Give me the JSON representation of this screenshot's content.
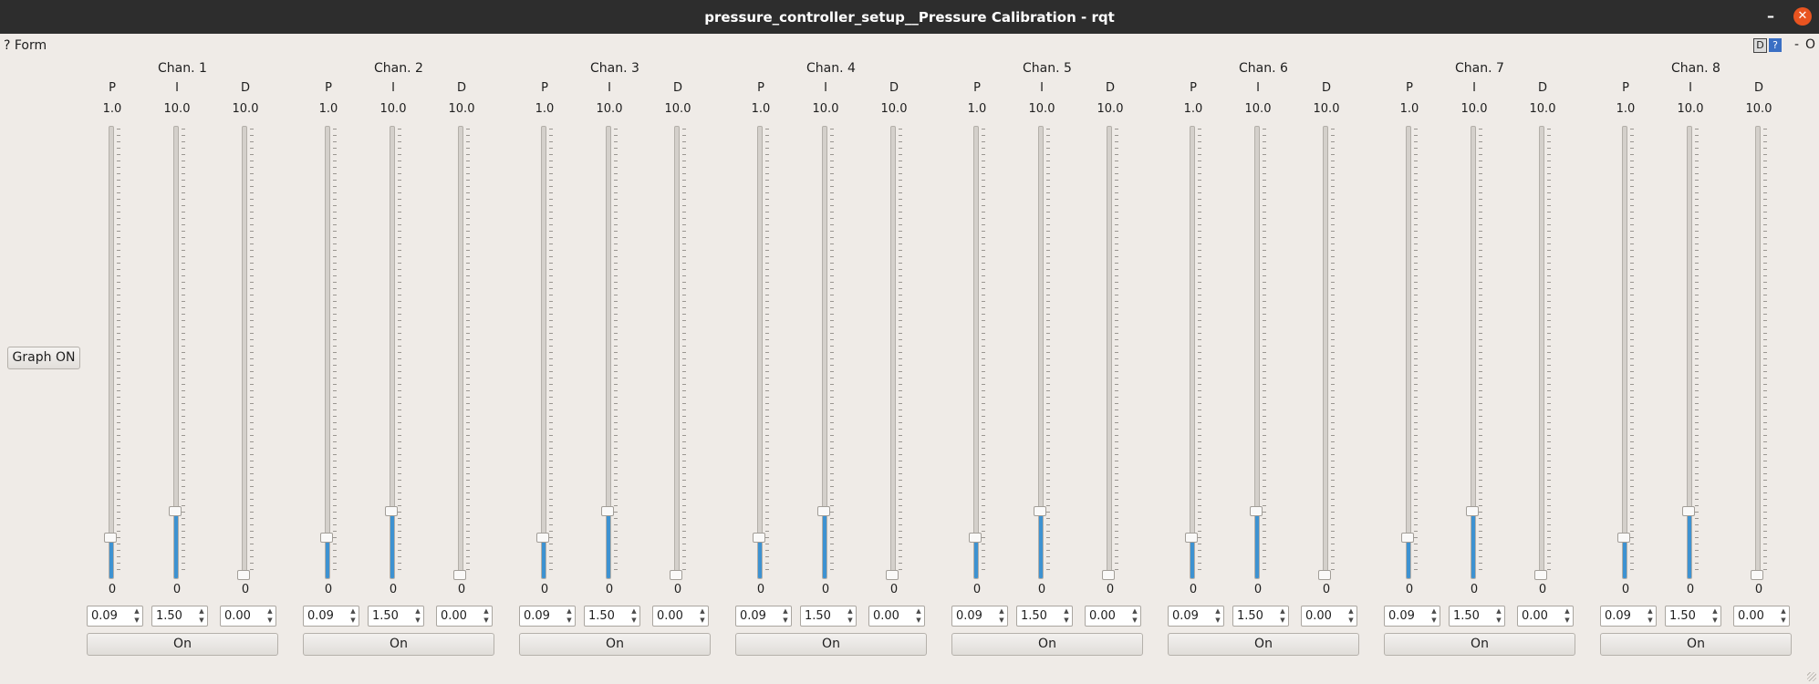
{
  "window": {
    "title": "pressure_controller_setup__Pressure Calibration - rqt",
    "minimize_glyph": "–",
    "close_glyph": "✕"
  },
  "plugin_bar": {
    "form_label": "? Form",
    "d_label": "D",
    "help_label": "?",
    "dash_label": "-",
    "o_label": "O"
  },
  "graph_button": "Graph ON",
  "channels": [
    {
      "title": "Chan. 1",
      "on_label": "On",
      "params": [
        {
          "name": "P",
          "max": "1.0",
          "min": "0",
          "value": "0.09",
          "level": 0.09
        },
        {
          "name": "I",
          "max": "10.0",
          "min": "0",
          "value": "1.50",
          "level": 0.15
        },
        {
          "name": "D",
          "max": "10.0",
          "min": "0",
          "value": "0.00",
          "level": 0.0
        }
      ]
    },
    {
      "title": "Chan. 2",
      "on_label": "On",
      "params": [
        {
          "name": "P",
          "max": "1.0",
          "min": "0",
          "value": "0.09",
          "level": 0.09
        },
        {
          "name": "I",
          "max": "10.0",
          "min": "0",
          "value": "1.50",
          "level": 0.15
        },
        {
          "name": "D",
          "max": "10.0",
          "min": "0",
          "value": "0.00",
          "level": 0.0
        }
      ]
    },
    {
      "title": "Chan. 3",
      "on_label": "On",
      "params": [
        {
          "name": "P",
          "max": "1.0",
          "min": "0",
          "value": "0.09",
          "level": 0.09
        },
        {
          "name": "I",
          "max": "10.0",
          "min": "0",
          "value": "1.50",
          "level": 0.15
        },
        {
          "name": "D",
          "max": "10.0",
          "min": "0",
          "value": "0.00",
          "level": 0.0
        }
      ]
    },
    {
      "title": "Chan. 4",
      "on_label": "On",
      "params": [
        {
          "name": "P",
          "max": "1.0",
          "min": "0",
          "value": "0.09",
          "level": 0.09
        },
        {
          "name": "I",
          "max": "10.0",
          "min": "0",
          "value": "1.50",
          "level": 0.15
        },
        {
          "name": "D",
          "max": "10.0",
          "min": "0",
          "value": "0.00",
          "level": 0.0
        }
      ]
    },
    {
      "title": "Chan. 5",
      "on_label": "On",
      "params": [
        {
          "name": "P",
          "max": "1.0",
          "min": "0",
          "value": "0.09",
          "level": 0.09
        },
        {
          "name": "I",
          "max": "10.0",
          "min": "0",
          "value": "1.50",
          "level": 0.15
        },
        {
          "name": "D",
          "max": "10.0",
          "min": "0",
          "value": "0.00",
          "level": 0.0
        }
      ]
    },
    {
      "title": "Chan. 6",
      "on_label": "On",
      "params": [
        {
          "name": "P",
          "max": "1.0",
          "min": "0",
          "value": "0.09",
          "level": 0.09
        },
        {
          "name": "I",
          "max": "10.0",
          "min": "0",
          "value": "1.50",
          "level": 0.15
        },
        {
          "name": "D",
          "max": "10.0",
          "min": "0",
          "value": "0.00",
          "level": 0.0
        }
      ]
    },
    {
      "title": "Chan. 7",
      "on_label": "On",
      "params": [
        {
          "name": "P",
          "max": "1.0",
          "min": "0",
          "value": "0.09",
          "level": 0.09
        },
        {
          "name": "I",
          "max": "10.0",
          "min": "0",
          "value": "1.50",
          "level": 0.15
        },
        {
          "name": "D",
          "max": "10.0",
          "min": "0",
          "value": "0.00",
          "level": 0.0
        }
      ]
    },
    {
      "title": "Chan. 8",
      "on_label": "On",
      "params": [
        {
          "name": "P",
          "max": "1.0",
          "min": "0",
          "value": "0.09",
          "level": 0.09
        },
        {
          "name": "I",
          "max": "10.0",
          "min": "0",
          "value": "1.50",
          "level": 0.15
        },
        {
          "name": "D",
          "max": "10.0",
          "min": "0",
          "value": "0.00",
          "level": 0.0
        }
      ]
    }
  ],
  "colors": {
    "titlebar": "#2d2d2d",
    "close_button": "#e95420",
    "window_bg": "#efebe7",
    "slider_fill": "#3d92d1"
  }
}
